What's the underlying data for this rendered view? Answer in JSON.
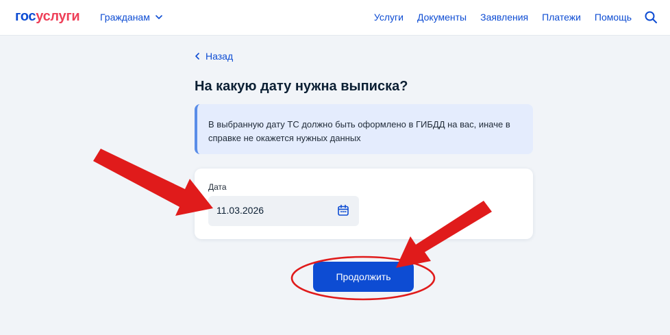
{
  "header": {
    "logo_part1": "гос",
    "logo_part2": "услуги",
    "audience": "Гражданам",
    "nav": [
      "Услуги",
      "Документы",
      "Заявления",
      "Платежи",
      "Помощь"
    ]
  },
  "main": {
    "back_label": "Назад",
    "title": "На какую дату нужна выписка?",
    "info_text": "В выбранную дату ТС должно быть оформлено в ГИБДД на вас, иначе в справке не окажется нужных данных",
    "date_label": "Дата",
    "date_value": "11.03.2026",
    "continue_label": "Продолжить"
  },
  "icons": {
    "chevron_down": "chevron-down-icon",
    "search": "search-icon",
    "back": "chevron-left-icon",
    "calendar": "calendar-icon"
  },
  "colors": {
    "brand_blue": "#0d4cd3",
    "brand_red": "#ee3f58",
    "info_bg": "#e4ecfd",
    "info_border": "#5a8de8",
    "annotation_red": "#e01b1b"
  }
}
